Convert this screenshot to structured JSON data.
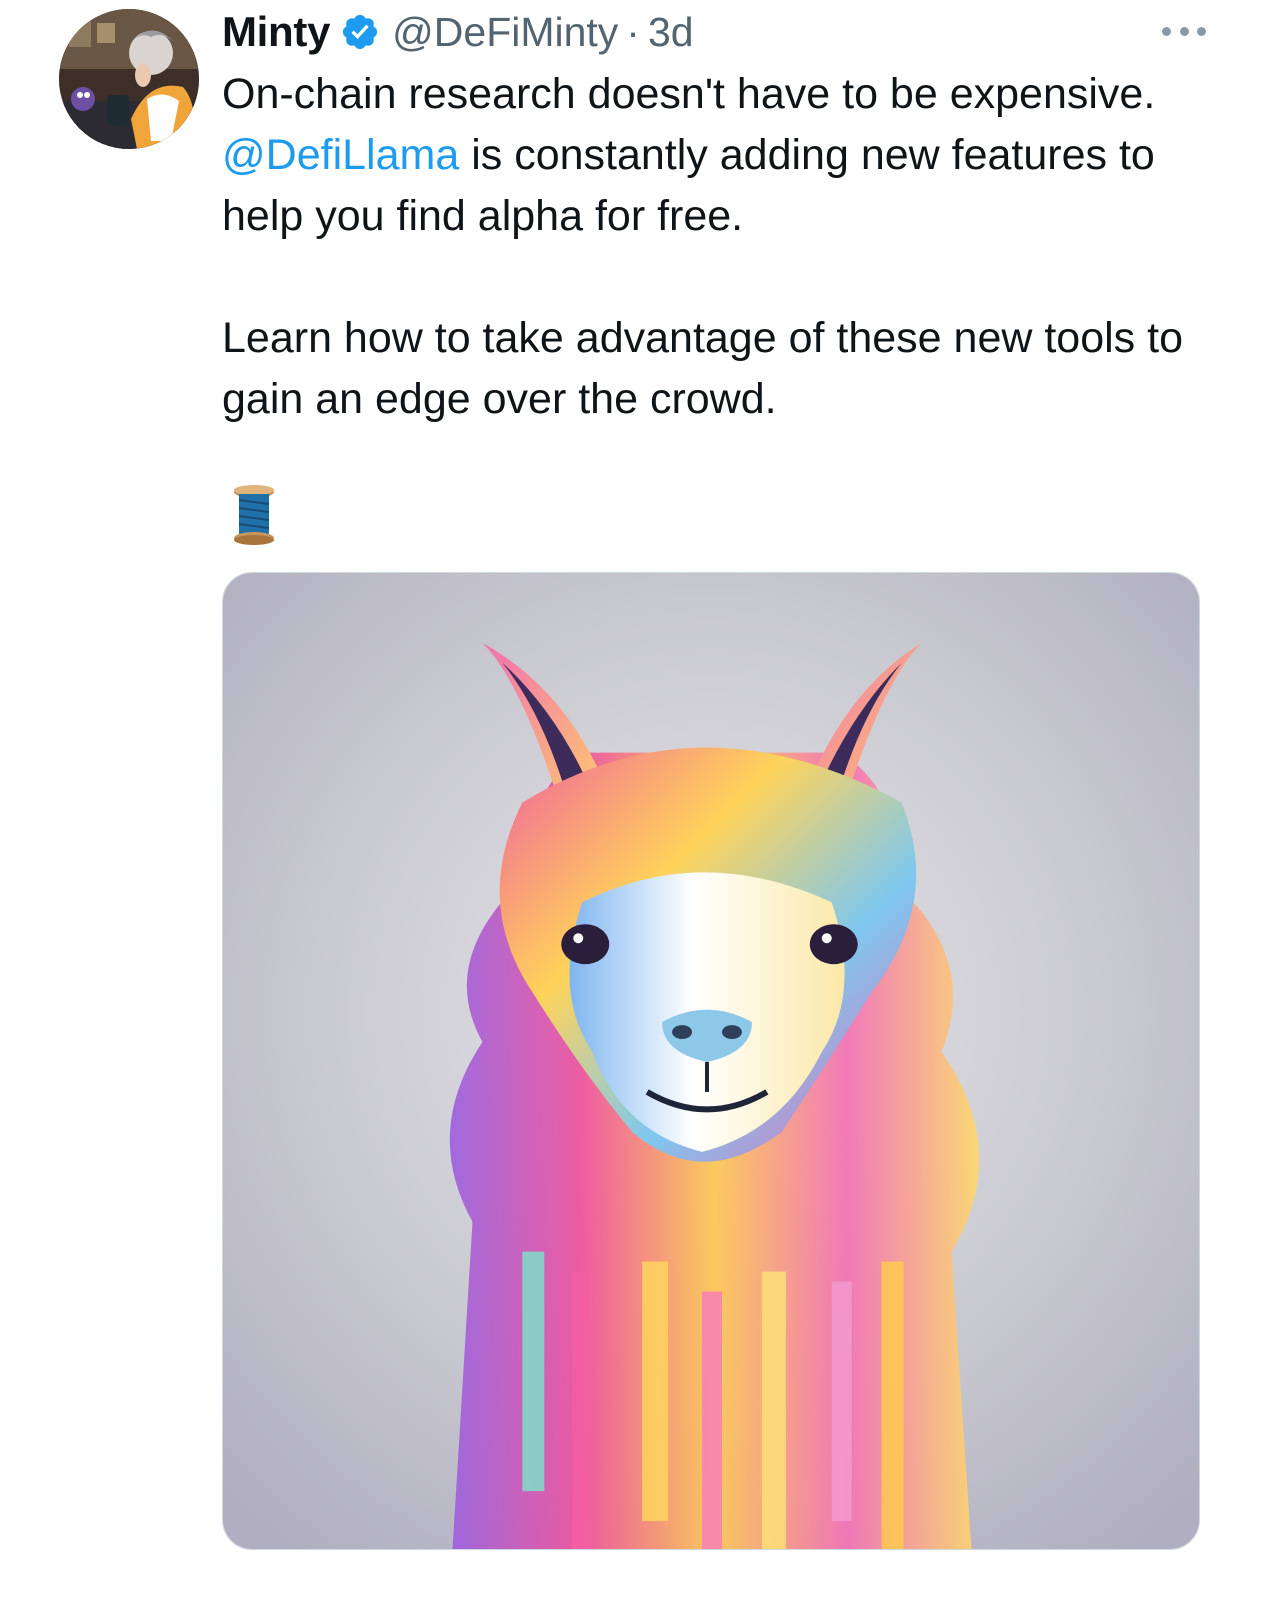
{
  "tweet": {
    "author": {
      "name": "Minty",
      "handle": "@DeFiMinty",
      "verified_icon": "verified-badge-icon",
      "avatar_icon": "avatar-illustration"
    },
    "separator": "·",
    "time": "3d",
    "more_icon": "more-options-icon",
    "text": {
      "line1_before": "On-chain research doesn't have to be expensive. ",
      "mention": "@DefiLlama",
      "line1_after": " is constantly adding new features to help you find alpha for free.",
      "para2": "Learn how to take advantage of these new tools to gain an edge over the crowd."
    },
    "thread_emoji": "🧵",
    "media": {
      "type": "image",
      "subject": "llama-illustration"
    }
  },
  "colors": {
    "text": "#0f1419",
    "secondary": "#536471",
    "link": "#1d9bf0",
    "verified": "#1d9bf0"
  }
}
